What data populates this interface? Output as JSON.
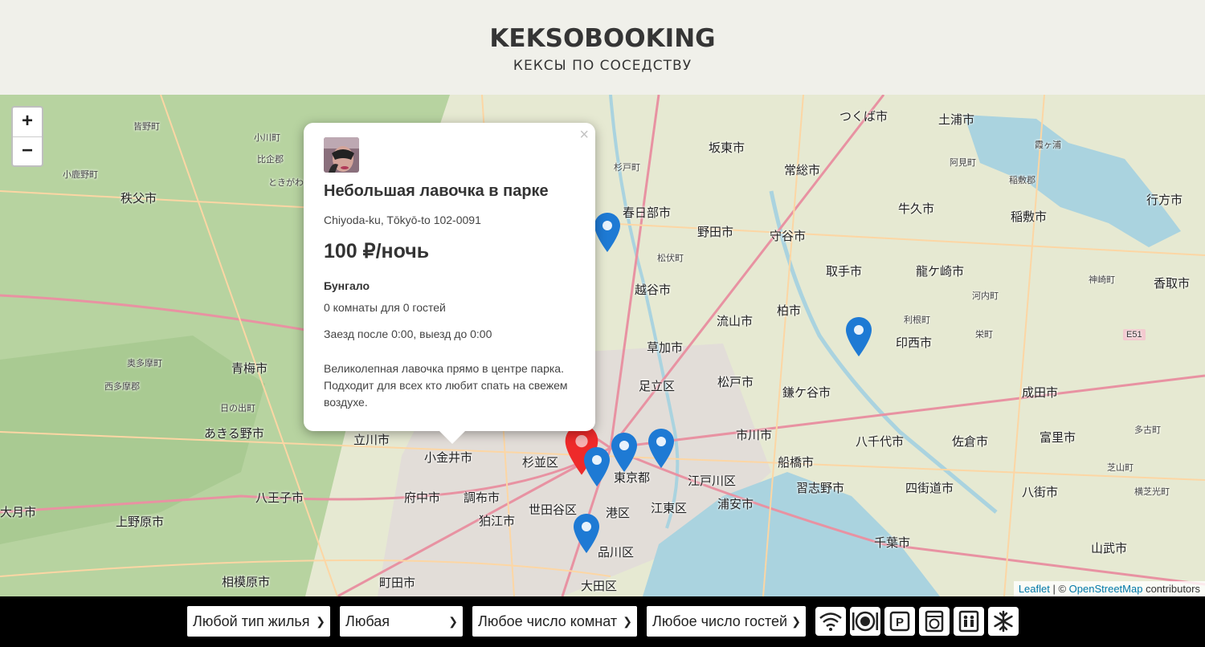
{
  "header": {
    "logo": "KEKSOBOOKING",
    "tagline": "КЕКСЫ ПО СОСЕДСТВУ"
  },
  "map": {
    "zoom_in": "+",
    "zoom_out": "−",
    "places": [
      "つくば市",
      "土浦市",
      "坂東市",
      "常総市",
      "牛久市",
      "行方市",
      "稲敷市",
      "春日部市",
      "野田市",
      "守谷市",
      "越谷市",
      "取手市",
      "龍ケ崎市",
      "香取市",
      "柏市",
      "流山市",
      "印西市",
      "草加市",
      "足立区",
      "松戸市",
      "鎌ケ谷市",
      "成田市",
      "青梅市",
      "あきる野市",
      "立川市",
      "小金井市",
      "杉並区",
      "市川市",
      "八千代市",
      "佐倉市",
      "富里市",
      "東京都",
      "江戸川区",
      "船橋市",
      "八王子市",
      "府中市",
      "調布市",
      "世田谷区",
      "港区",
      "江東区",
      "浦安市",
      "習志野市",
      "四街道市",
      "八街市",
      "上野原市",
      "狛江市",
      "品川区",
      "千葉市",
      "山武市",
      "相模原市",
      "町田市",
      "大田区",
      "秩父市",
      "大月市"
    ],
    "small_places": [
      "皆野町",
      "小川町",
      "小鹿野町",
      "ときがわ",
      "比企郡",
      "奥多摩町",
      "西多摩郡",
      "日の出町",
      "霞ヶ浦",
      "阿見町",
      "稲敷郡",
      "神崎町",
      "河内町",
      "利根町",
      "栄町",
      "多古町",
      "芝山町",
      "横芝光町",
      "松伏町",
      "杉戸町",
      "E51"
    ],
    "attribution": {
      "leaflet": "Leaflet",
      "sep": " | © ",
      "osm": "OpenStreetMap",
      "tail": " contributors"
    },
    "pin_color": "#1e7ad4",
    "main_pin_color": "#ee2a2a"
  },
  "popup": {
    "close": "×",
    "title": "Небольшая лавочка в парке",
    "address": "Chiyoda-ku, Tōkyō-to 102-0091",
    "price": "100 ₽/ночь",
    "type": "Бунгало",
    "capacity": "0 комнаты для 0 гостей",
    "time": "Заезд после 0:00, выезд до 0:00",
    "description": "Великолепная лавочка прямо в центре парка. Подходит для всех кто любит спать на свежем воздухе."
  },
  "filters": {
    "type": "Любой тип жилья",
    "price": "Любая",
    "rooms": "Любое число комнат",
    "guests": "Любое число гостей",
    "features": [
      "wifi-icon",
      "dishwasher-icon",
      "parking-icon",
      "washer-icon",
      "elevator-icon",
      "conditioner-icon"
    ]
  }
}
